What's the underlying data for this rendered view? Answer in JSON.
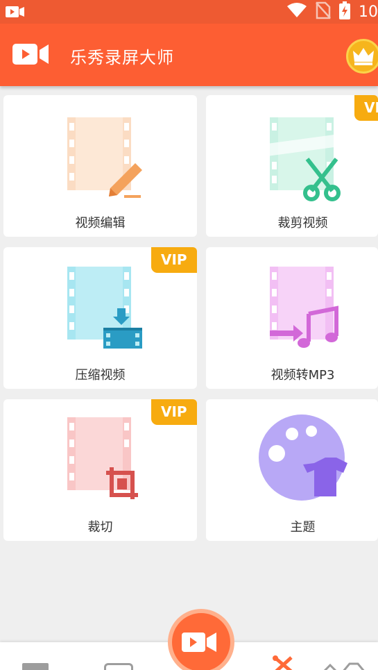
{
  "status_bar": {
    "time": "10",
    "icons": [
      "screen-record-notification-icon",
      "wifi-icon",
      "no-sim-icon",
      "battery-charging-icon"
    ]
  },
  "app_bar": {
    "title": "乐秀录屏大师",
    "logo_icon": "video-camera-icon",
    "vip_icon": "crown-icon"
  },
  "tools": [
    {
      "label": "视频编辑",
      "icon": "video-edit-icon",
      "vip": false
    },
    {
      "label": "裁剪视频",
      "icon": "video-trim-icon",
      "vip": true,
      "vip_label": "VIP"
    },
    {
      "label": "压缩视频",
      "icon": "video-compress-icon",
      "vip": true,
      "vip_label": "VIP"
    },
    {
      "label": "视频转MP3",
      "icon": "video-to-mp3-icon",
      "vip": false
    },
    {
      "label": "裁切",
      "icon": "crop-icon",
      "vip": true,
      "vip_label": "VIP"
    },
    {
      "label": "主题",
      "icon": "theme-palette-icon",
      "vip": false
    }
  ],
  "bottom_nav": {
    "record_icon": "video-camera-icon",
    "items": [
      "video-list-icon",
      "screenshot-icon",
      "tools-icon",
      "settings-icon"
    ]
  },
  "colors": {
    "accent": "#fd5e33",
    "vip_badge": "#f7ab10",
    "background": "#efefef"
  }
}
